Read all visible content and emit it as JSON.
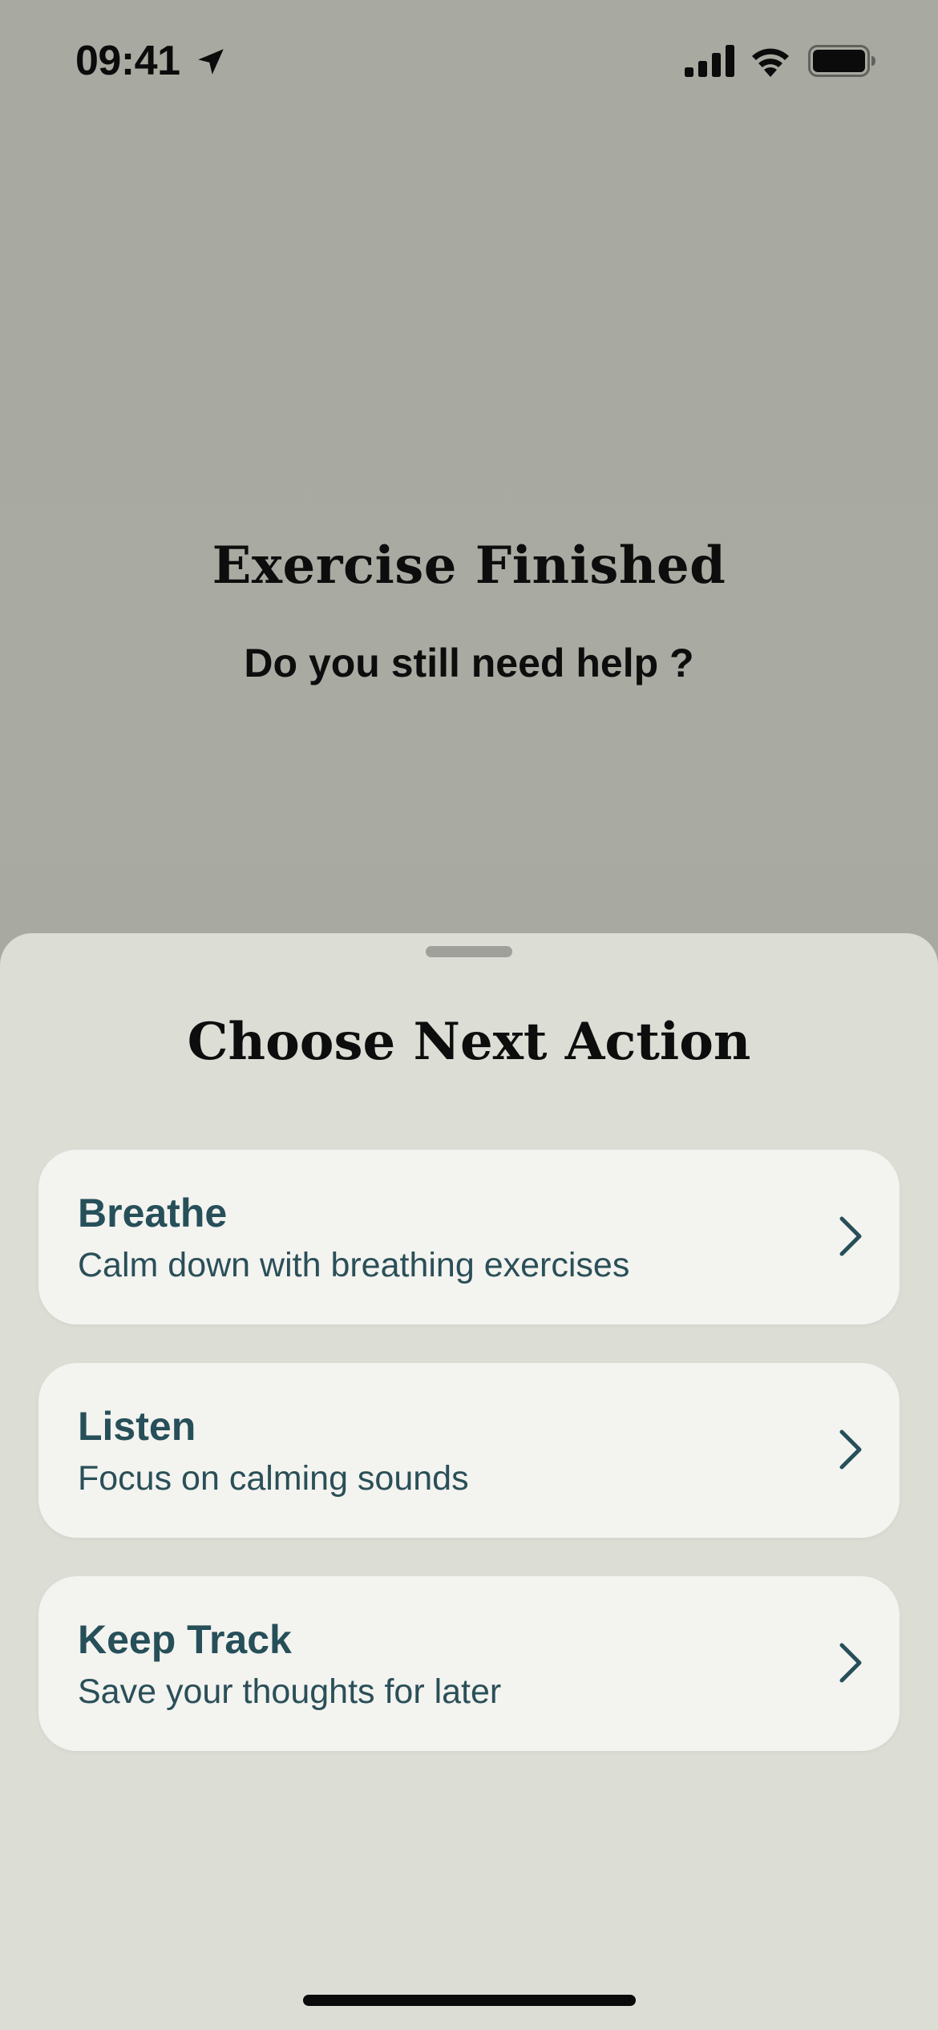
{
  "status_bar": {
    "time": "09:41",
    "location_icon": "location-arrow-icon",
    "signal_icon": "cellular-signal-icon",
    "wifi_icon": "wifi-icon",
    "battery_icon": "battery-icon"
  },
  "header": {
    "title": "Exercise Finished",
    "subtitle": "Do you still need help ?"
  },
  "sheet": {
    "title": "Choose Next Action",
    "actions": [
      {
        "title": "Breathe",
        "description": "Calm down with breathing exercises",
        "icon": "chevron-right-icon"
      },
      {
        "title": "Listen",
        "description": "Focus on calming sounds",
        "icon": "chevron-right-icon"
      },
      {
        "title": "Keep Track",
        "description": "Save your thoughts for later",
        "icon": "chevron-right-icon"
      }
    ]
  },
  "colors": {
    "background": "#a8aaa1",
    "sheet": "#dcddd5",
    "card": "#f3f3ef",
    "accent_text": "#264f59"
  }
}
